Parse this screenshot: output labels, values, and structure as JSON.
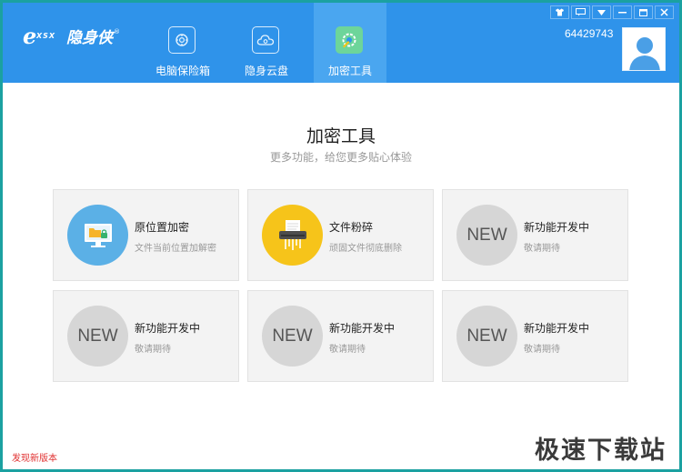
{
  "app": {
    "logo_mark": "e",
    "logo_sub": "XSX",
    "logo_text": "隐身侠",
    "logo_reg": "®"
  },
  "nav": {
    "items": [
      {
        "label": "电脑保险箱",
        "icon": "safe-icon"
      },
      {
        "label": "隐身云盘",
        "icon": "cloud-icon"
      },
      {
        "label": "加密工具",
        "icon": "tools-icon",
        "active": true
      }
    ]
  },
  "user": {
    "id": "64429743",
    "avatar_icon": "user-avatar-icon"
  },
  "titlebar": {
    "buttons": [
      "skin-icon",
      "message-icon",
      "menu-icon",
      "minimize-icon",
      "maximize-icon",
      "close-icon"
    ]
  },
  "main": {
    "title": "加密工具",
    "subtitle": "更多功能，给您更多贴心体验",
    "cards": [
      {
        "title": "原位置加密",
        "desc": "文件当前位置加解密",
        "icon": "folder-monitor-icon"
      },
      {
        "title": "文件粉碎",
        "desc": "顽固文件彻底删除",
        "icon": "shredder-icon"
      },
      {
        "title": "新功能开发中",
        "desc": "敬请期待",
        "badge": "NEW"
      },
      {
        "title": "新功能开发中",
        "desc": "敬请期待",
        "badge": "NEW"
      },
      {
        "title": "新功能开发中",
        "desc": "敬请期待",
        "badge": "NEW"
      },
      {
        "title": "新功能开发中",
        "desc": "敬请期待",
        "badge": "NEW"
      }
    ]
  },
  "status": {
    "text": "发现新版本"
  },
  "watermark": {
    "text": "极速下载站"
  },
  "colors": {
    "header": "#2f93ea",
    "active_tab": "#4aa6f0",
    "frame": "#1ba1a1",
    "status_text": "#e03030"
  }
}
